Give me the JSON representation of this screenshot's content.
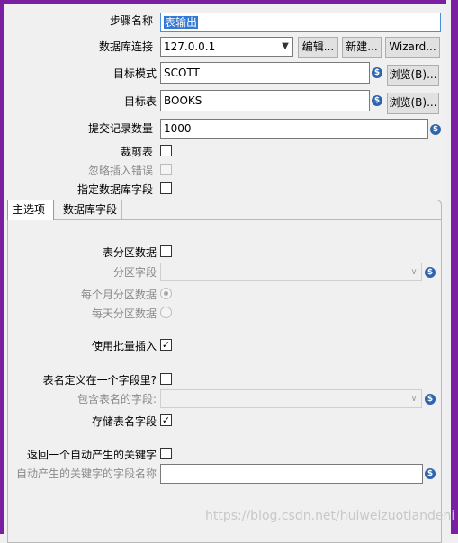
{
  "form": {
    "step_name_label": "步骤名称",
    "step_name_value": "表输出",
    "connection_label": "数据库连接",
    "connection_value": "127.0.0.1",
    "edit_button": "编辑...",
    "new_button": "新建...",
    "wizard_button": "Wizard...",
    "target_schema_label": "目标模式",
    "target_schema_value": "SCOTT",
    "browse_button": "浏览(B)...",
    "target_table_label": "目标表",
    "target_table_value": "BOOKS",
    "commit_size_label": "提交记录数量",
    "commit_size_value": "1000",
    "truncate_label": "裁剪表",
    "ignore_errors_label": "忽略插入错误",
    "specify_fields_label": "指定数据库字段"
  },
  "tabs": [
    {
      "label": "主选项",
      "active": true
    },
    {
      "label": "数据库字段",
      "active": false
    }
  ],
  "main_options": {
    "partition_label": "表分区数据",
    "partition_field_label": "分区字段",
    "partition_monthly_label": "每个月分区数据",
    "partition_daily_label": "每天分区数据",
    "batch_insert_label": "使用批量插入",
    "batch_insert_checked": true,
    "tablename_in_field_label": "表名定义在一个字段里?",
    "tablename_field_label": "包含表名的字段:",
    "store_tablename_label": "存储表名字段",
    "store_tablename_checked": true,
    "return_key_label": "返回一个自动产生的关键字",
    "return_key_field_label": "自动产生的关键字的字段名称"
  },
  "icons": {
    "variable": "variable-dollar-icon",
    "dropdown": "chevron-down-icon",
    "check": "checkmark-icon"
  },
  "watermark": "https://blog.csdn.net/huiweizuotiandeni",
  "colors": {
    "window_border": "#7a1fa2",
    "selection": "#3478d4",
    "variable_icon": "#2e64ad"
  }
}
